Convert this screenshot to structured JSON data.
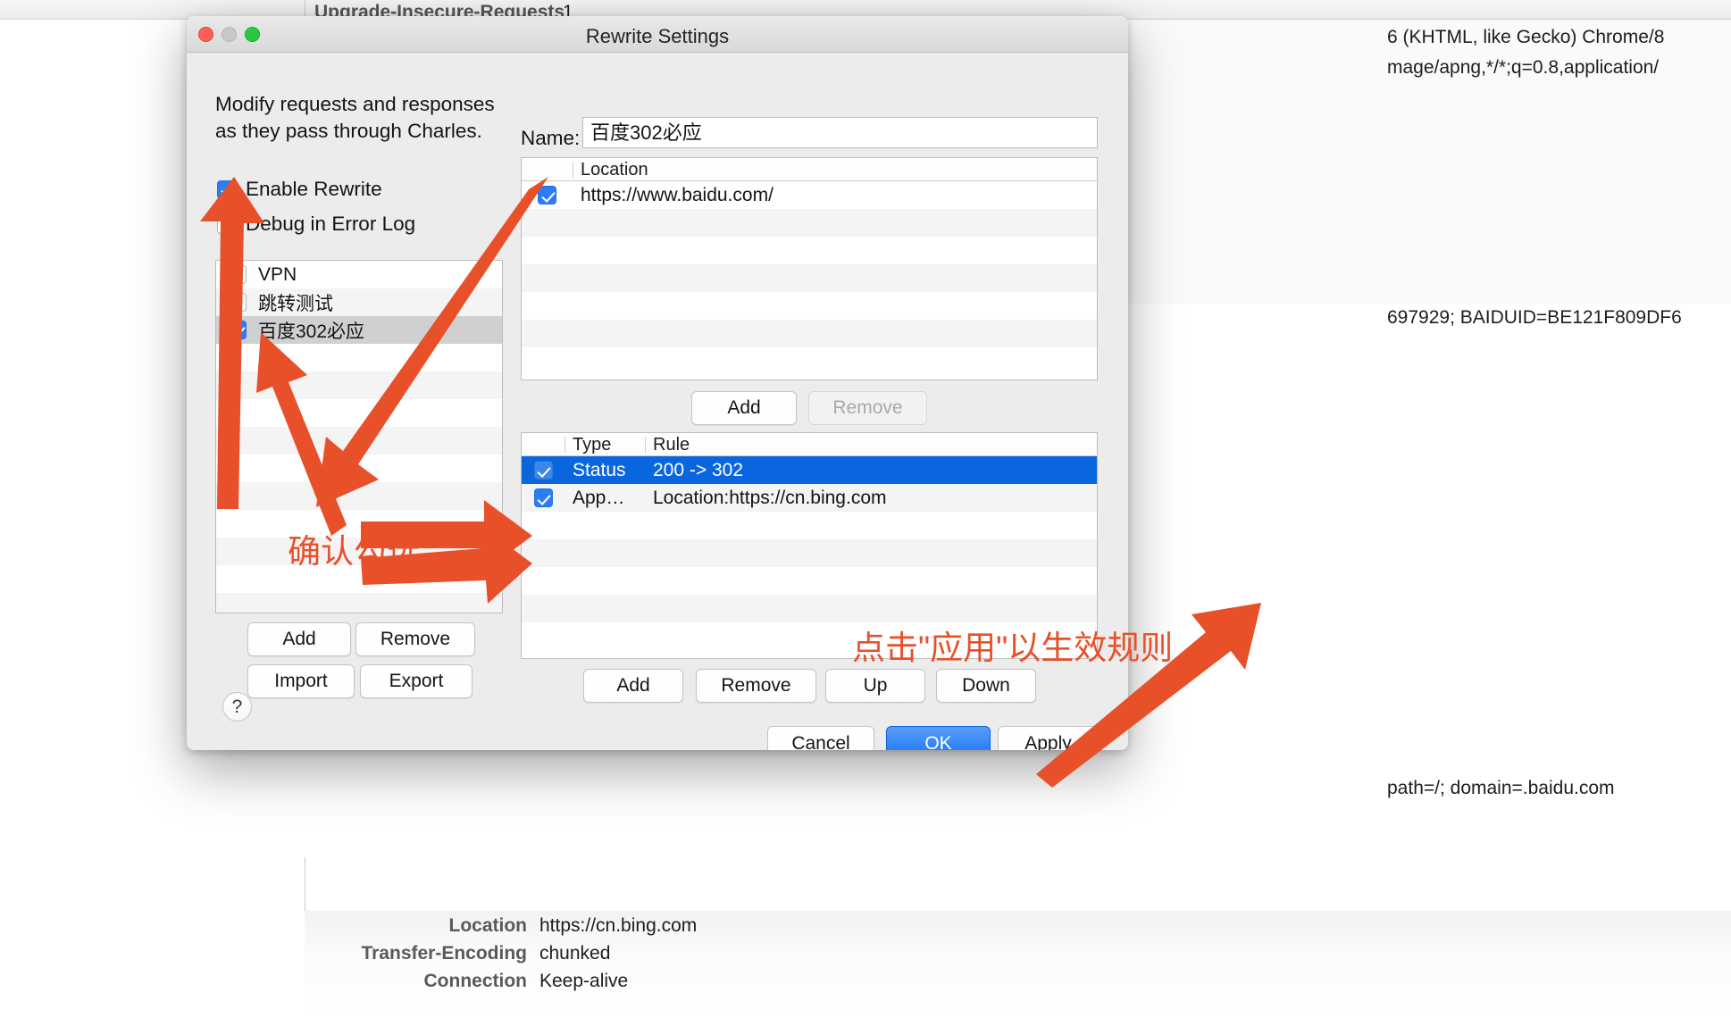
{
  "background": {
    "top_header": "Upgrade-Insecure-Requests",
    "top_header_value": "1",
    "right_lines": [
      "6 (KHTML, like Gecko) Chrome/8",
      "mage/apng,*/*;q=0.8,application/",
      "697929; BAIDUID=BE121F809DF6",
      "path=/; domain=.baidu.com"
    ],
    "bottom_rows": [
      {
        "label": "Location",
        "value": "https://cn.bing.com"
      },
      {
        "label": "Transfer-Encoding",
        "value": "chunked"
      },
      {
        "label": "Connection",
        "value": "Keep-alive"
      }
    ]
  },
  "dialog": {
    "title": "Rewrite Settings",
    "window_controls": {
      "close": "close-button",
      "minimize": "minimize-button",
      "zoom": "zoom-button"
    },
    "intro": "Modify requests and responses as they pass through Charles.",
    "options": [
      {
        "label": "Enable Rewrite",
        "checked": true
      },
      {
        "label": "Debug in Error Log",
        "checked": false
      }
    ],
    "rule_sets": [
      {
        "label": "VPN",
        "checked": false,
        "selected": false
      },
      {
        "label": "跳转测试",
        "checked": false,
        "selected": false
      },
      {
        "label": "百度302必应",
        "checked": true,
        "selected": true
      }
    ],
    "left_buttons": [
      {
        "label": "Add",
        "disabled": false
      },
      {
        "label": "Remove",
        "disabled": false
      },
      {
        "label": "Import",
        "disabled": false
      },
      {
        "label": "Export",
        "disabled": false
      }
    ],
    "name_label": "Name:",
    "name_value": "百度302必应",
    "location_table": {
      "columns": [
        "",
        "Location"
      ],
      "rows": [
        {
          "checked": true,
          "location": "https://www.baidu.com/"
        }
      ]
    },
    "location_buttons": [
      {
        "label": "Add",
        "disabled": false
      },
      {
        "label": "Remove",
        "disabled": true
      }
    ],
    "rules_table": {
      "columns": [
        "",
        "Type",
        "Rule"
      ],
      "rows": [
        {
          "checked": true,
          "type": "Status",
          "rule": "200 -> 302",
          "selected": true
        },
        {
          "checked": true,
          "type": "App…",
          "rule": "Location:https://cn.bing.com",
          "selected": false
        }
      ]
    },
    "rules_buttons": [
      {
        "label": "Add",
        "disabled": false
      },
      {
        "label": "Remove",
        "disabled": false
      },
      {
        "label": "Up",
        "disabled": false
      },
      {
        "label": "Down",
        "disabled": false
      }
    ],
    "help_label": "?",
    "footer_buttons": [
      {
        "label": "Cancel",
        "primary": false
      },
      {
        "label": "OK",
        "primary": true
      },
      {
        "label": "Apply",
        "primary": false
      }
    ]
  },
  "annotations": {
    "accent_color": "#e8502a",
    "notes": [
      {
        "text": "确认勾选"
      },
      {
        "text": "点击\"应用\"以生效规则"
      }
    ]
  }
}
